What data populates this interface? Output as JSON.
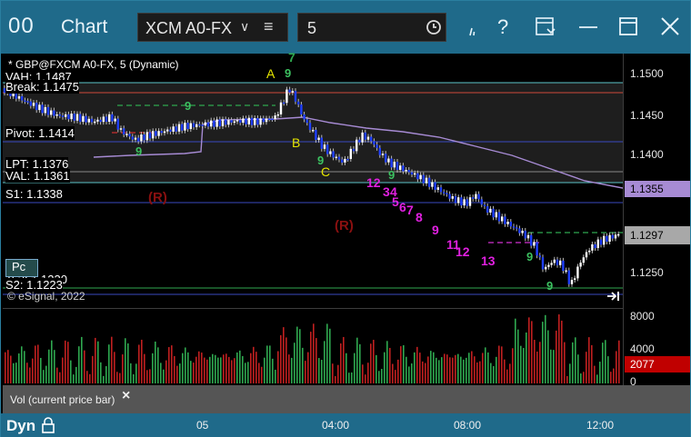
{
  "titlebar": {
    "logo": "00",
    "title": "Chart",
    "symbol": "XCM A0-FX",
    "interval": "5"
  },
  "chart": {
    "study_label": "* GBP@FXCM A0-FX, 5 (Dynamic)",
    "copyright": "© eSignal, 2022",
    "levels": {
      "vah": "VAH: 1.1487",
      "break": "Break: 1.1475",
      "pivot": "Pivot: 1.1414",
      "lpt": "LPT: 1.1376",
      "val": "VAL: 1.1361",
      "s1": "S1: 1.1338",
      "s2": "S2: 1.1223",
      "s2_hidden": "T: 2: 1.1230"
    },
    "markers": {
      "r1": "(R)",
      "r2": "(R)",
      "a": "A",
      "b": "B",
      "c": "C",
      "seven": "7",
      "pc": "Pc"
    },
    "count_labels": [
      "12",
      "3",
      "4",
      "5",
      "6",
      "7",
      "8",
      "9",
      "11",
      "12",
      "13"
    ],
    "green_labels": [
      "9",
      "9",
      "9",
      "9",
      "9",
      "9",
      "9"
    ]
  },
  "price_axis": {
    "ticks": [
      "1.1500",
      "1.1450",
      "1.1400",
      "1.1250"
    ],
    "highlight_ma": "1.1355",
    "highlight_last": "1.1297",
    "colors": {
      "ma": "#a78bd4",
      "last": "#a8a8a8",
      "vol_last": "#c00000"
    }
  },
  "volume_axis": {
    "ticks": [
      "8000",
      "4000",
      "0"
    ],
    "last": "2077"
  },
  "volume_panel": {
    "label": "Vol (current price bar)",
    "close": "×"
  },
  "time_axis": {
    "mode": "Dyn",
    "labels": [
      "05",
      "04:00",
      "08:00",
      "12:00"
    ]
  }
}
